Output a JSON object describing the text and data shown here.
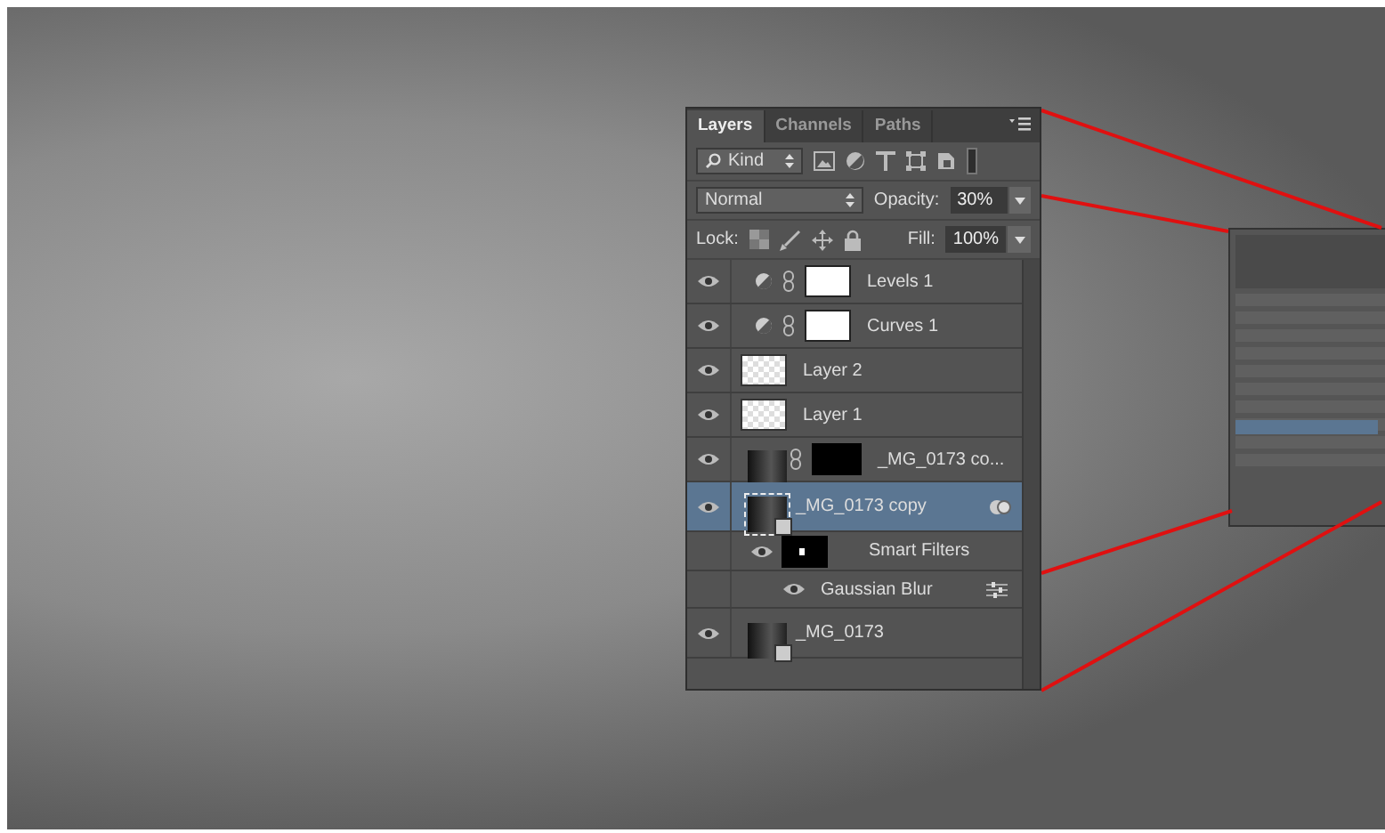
{
  "tabs": [
    {
      "label": "Layers",
      "selected": true
    },
    {
      "label": "Channels",
      "selected": false
    },
    {
      "label": "Paths",
      "selected": false
    }
  ],
  "filter": {
    "value": "Kind"
  },
  "blend_mode": {
    "value": "Normal"
  },
  "opacity": {
    "label": "Opacity:",
    "value": "30%"
  },
  "lock": {
    "label": "Lock:"
  },
  "fill": {
    "label": "Fill:",
    "value": "100%"
  },
  "layers": [
    {
      "kind": "adjustment",
      "name": "Levels 1",
      "visible": true,
      "selected": false
    },
    {
      "kind": "adjustment",
      "name": "Curves 1",
      "visible": true,
      "selected": false
    },
    {
      "kind": "pixel",
      "name": "Layer 2",
      "visible": true,
      "selected": false
    },
    {
      "kind": "pixel",
      "name": "Layer 1",
      "visible": true,
      "selected": false
    },
    {
      "kind": "masked",
      "name": "_MG_0173 co...",
      "visible": true,
      "selected": false
    },
    {
      "kind": "smart",
      "name": "_MG_0173 copy",
      "visible": true,
      "selected": true,
      "children": [
        {
          "kind": "smart-filters",
          "name": "Smart Filters",
          "visible": true,
          "children": [
            {
              "kind": "filter",
              "name": "Gaussian Blur",
              "visible": true
            }
          ]
        }
      ]
    },
    {
      "kind": "smart",
      "name": "_MG_0173",
      "visible": true,
      "selected": false
    }
  ]
}
